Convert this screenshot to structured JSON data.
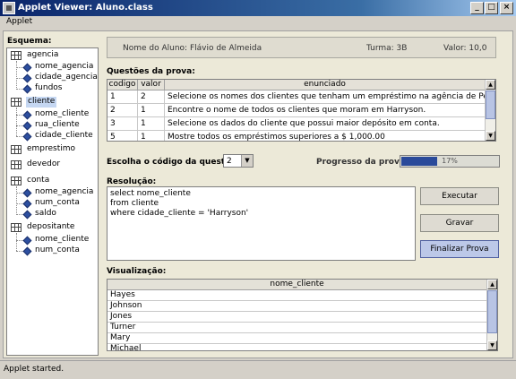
{
  "window": {
    "title": "Applet Viewer: Aluno.class",
    "minimize": "_",
    "maximize": "□",
    "close": "×"
  },
  "menu": {
    "applet": "Applet"
  },
  "schema": {
    "label": "Esquema:",
    "tables": [
      {
        "name": "agencia",
        "fields": [
          "nome_agencia",
          "cidade_agencia",
          "fundos"
        ]
      },
      {
        "name": "cliente",
        "fields": [
          "nome_cliente",
          "rua_cliente",
          "cidade_cliente"
        ]
      },
      {
        "name": "emprestimo",
        "fields": []
      },
      {
        "name": "devedor",
        "fields": []
      },
      {
        "name": "conta",
        "fields": [
          "nome_agencia",
          "num_conta",
          "saldo"
        ]
      },
      {
        "name": "depositante",
        "fields": [
          "nome_cliente",
          "num_conta"
        ]
      }
    ]
  },
  "header": {
    "student": "Nome do Aluno: Flávio de Almeida",
    "turma": "Turma: 3B",
    "valor": "Valor: 10,0"
  },
  "questions": {
    "label": "Questões da prova:",
    "columns": [
      "codigo",
      "valor",
      "enunciado"
    ],
    "rows": [
      [
        "1",
        "2",
        "Selecione os nomes dos clientes que tenham um empréstimo na agência de Perryridge."
      ],
      [
        "2",
        "1",
        "Encontre o nome de todos os clientes que moram em Harryson."
      ],
      [
        "3",
        "1",
        "Selecione os dados do cliente que possui maior depósito em conta."
      ],
      [
        "5",
        "1",
        "Mostre todos os empréstimos superiores a $ 1,000.00"
      ]
    ],
    "scroll_up": "▲",
    "scroll_down": "▼"
  },
  "chooser": {
    "label": "Escolha o código da questão:",
    "value": "2",
    "arrow": "▼"
  },
  "progress": {
    "label": "Progresso da prova:",
    "text": "17%",
    "value": 0.17
  },
  "resolution": {
    "label": "Resolução:",
    "lines": [
      "select nome_cliente",
      "from cliente",
      "where cidade_cliente = 'Harryson'"
    ]
  },
  "buttons": {
    "executar": "Executar",
    "gravar": "Gravar",
    "finalizar": "Finalizar Prova"
  },
  "visualization": {
    "label": "Visualização:",
    "column": "nome_cliente",
    "rows": [
      "Hayes",
      "Johnson",
      "Jones",
      "Turner",
      "Mary",
      "Michael"
    ]
  },
  "status": "Applet started."
}
